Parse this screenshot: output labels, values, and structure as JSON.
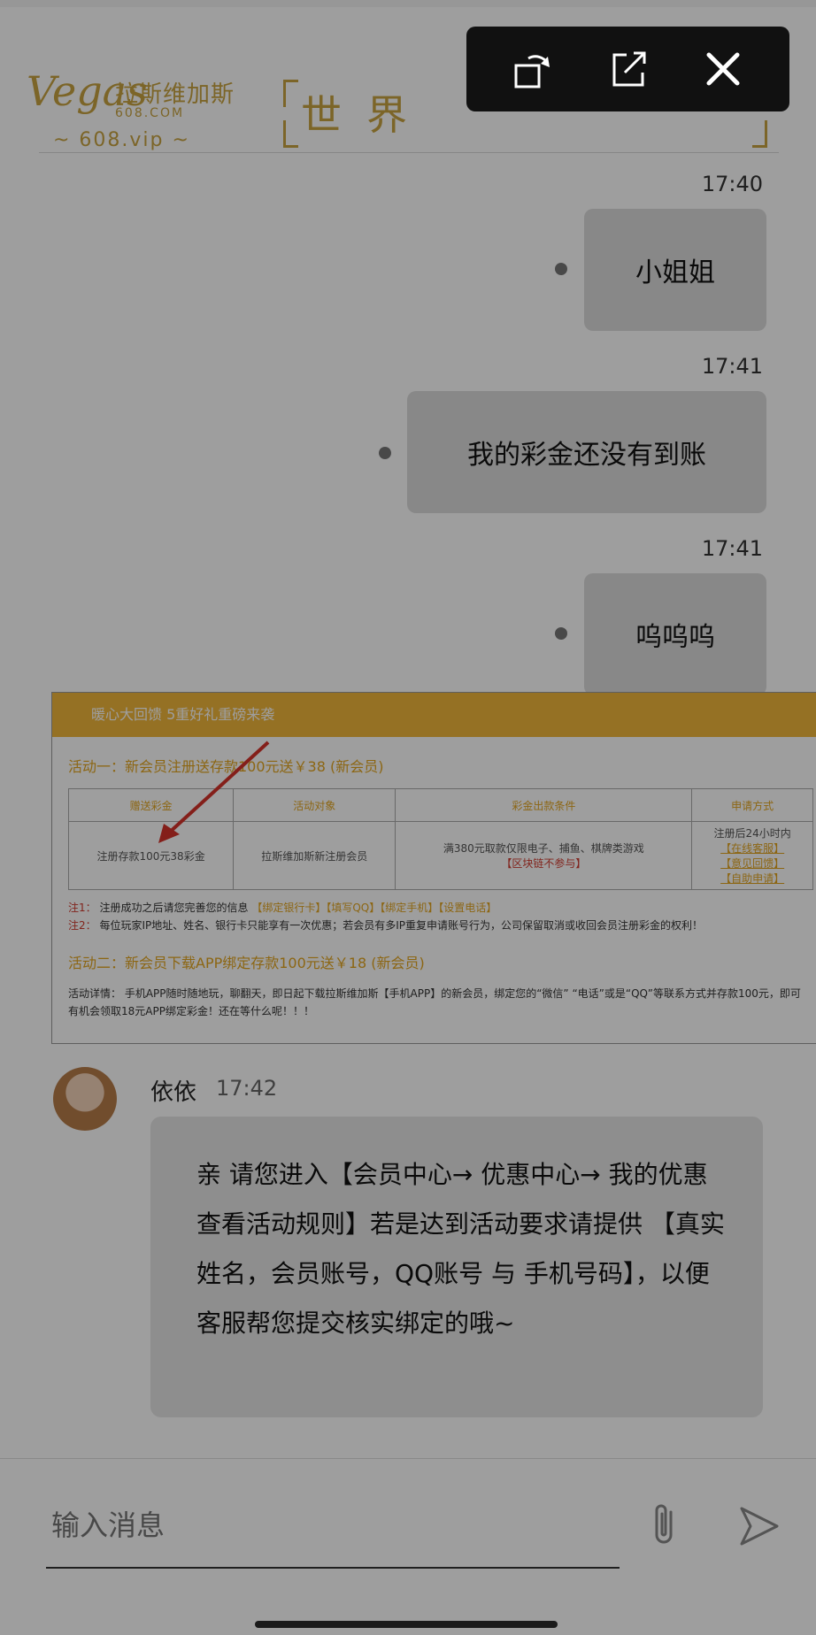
{
  "banner": {
    "logo_text": "Vegas",
    "brand_cn": "拉斯维加斯",
    "brand_domain": "608.COM",
    "vip_label": "~ 608.vip ~",
    "slogan": "世界"
  },
  "toolbar": {
    "rotate_icon": "rotate-icon",
    "open_icon": "open-external-icon",
    "close_icon": "close-icon"
  },
  "messages": [
    {
      "time": "17:40",
      "text": "小姐姐"
    },
    {
      "time": "17:41",
      "text": "我的彩金还没有到账"
    },
    {
      "time": "17:41",
      "text": "呜呜呜"
    }
  ],
  "image_message": {
    "header": "暖心大回馈 5重好礼重磅来袭",
    "activity1_title": "活动一：新会员注册送存款100元送￥38 (新会员)",
    "table_headers": [
      "赠送彩金",
      "活动对象",
      "彩金出款条件",
      "申请方式"
    ],
    "row": {
      "bonus": "注册存款100元38彩金",
      "target": "拉斯维加斯新注册会员",
      "condition": "满380元取款仅限电子、捕鱼、棋牌类游戏",
      "condition_note": "【区块链不参与】",
      "apply_time": "注册后24小时内",
      "apply_links": [
        "【在线客服】",
        "【意见回馈】",
        "【自助申请】"
      ]
    },
    "note1_tag": "注1：",
    "note1": "注册成功之后请您完善您的信息",
    "note1_items": "【绑定银行卡】【填写QQ】【绑定手机】【设置电话】",
    "note2_tag": "注2：",
    "note2": "每位玩家IP地址、姓名、银行卡只能享有一次优惠；若会员有多IP重复申请账号行为，公司保留取消或收回会员注册彩金的权利！",
    "activity2_title": "活动二：新会员下载APP绑定存款100元送￥18 (新会员)",
    "detail_tag": "活动详情：",
    "detail": "手机APP随时随地玩，聊翻天，即日起下载拉斯维加斯【手机APP】的新会员，绑定您的“微信” “电话”或是“QQ”等联系方式并存款100元，即可有机会领取18元APP绑定彩金！还在等什么呢！！！"
  },
  "incoming": {
    "sender": "依依",
    "time": "17:42",
    "text": "亲 请您进入【会员中心→ 优惠中心→ 我的优惠 查看活动规则】若是达到活动要求请提供 【真实姓名，会员账号，QQ账号 与 手机号码】，以便客服帮您提交核实绑定的哦~",
    "avatar_icon": "avatar"
  },
  "input": {
    "placeholder": "输入消息",
    "attach_icon": "paperclip-icon",
    "send_icon": "send-icon"
  }
}
